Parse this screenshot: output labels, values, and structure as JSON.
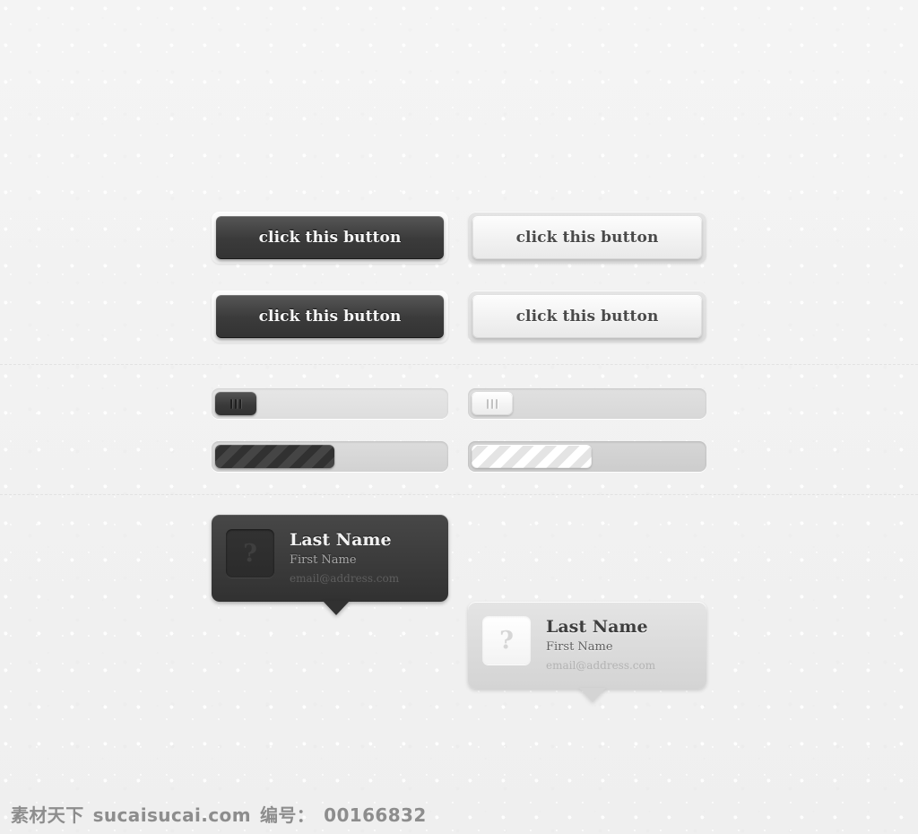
{
  "theme": {
    "background": "#f2f2f2",
    "dark_surface": "#3a3a3a",
    "light_surface": "#dadada",
    "dark_text": "#f6f6f6",
    "light_text": "#4a4a4a"
  },
  "sections": {
    "buttons": {
      "dark": [
        {
          "label": "click this button"
        },
        {
          "label": "click this button"
        }
      ],
      "light": [
        {
          "label": "click this button"
        },
        {
          "label": "click this button"
        }
      ]
    },
    "sliders": {
      "dark": {
        "handle_icon": "grip-lines-icon",
        "value": 0,
        "grips": 3
      },
      "light": {
        "handle_icon": "grip-lines-icon",
        "value": 0,
        "grips": 3
      }
    },
    "progress": {
      "dark": {
        "percent": 52,
        "stripe": "diagonal"
      },
      "light": {
        "percent": 52,
        "stripe": "diagonal"
      }
    },
    "cards": {
      "dark": {
        "avatar_glyph": "?",
        "avatar_icon": "avatar-placeholder-icon",
        "last_name": "Last Name",
        "first_name": "First Name",
        "email": "email@address.com"
      },
      "light": {
        "avatar_glyph": "?",
        "avatar_icon": "avatar-placeholder-icon",
        "last_name": "Last Name",
        "first_name": "First Name",
        "email": "email@address.com"
      }
    }
  },
  "watermark": {
    "site_cn": "素材天下",
    "site_url": "sucaisucai.com",
    "id_label": "编号：",
    "id_value": "00166832"
  }
}
